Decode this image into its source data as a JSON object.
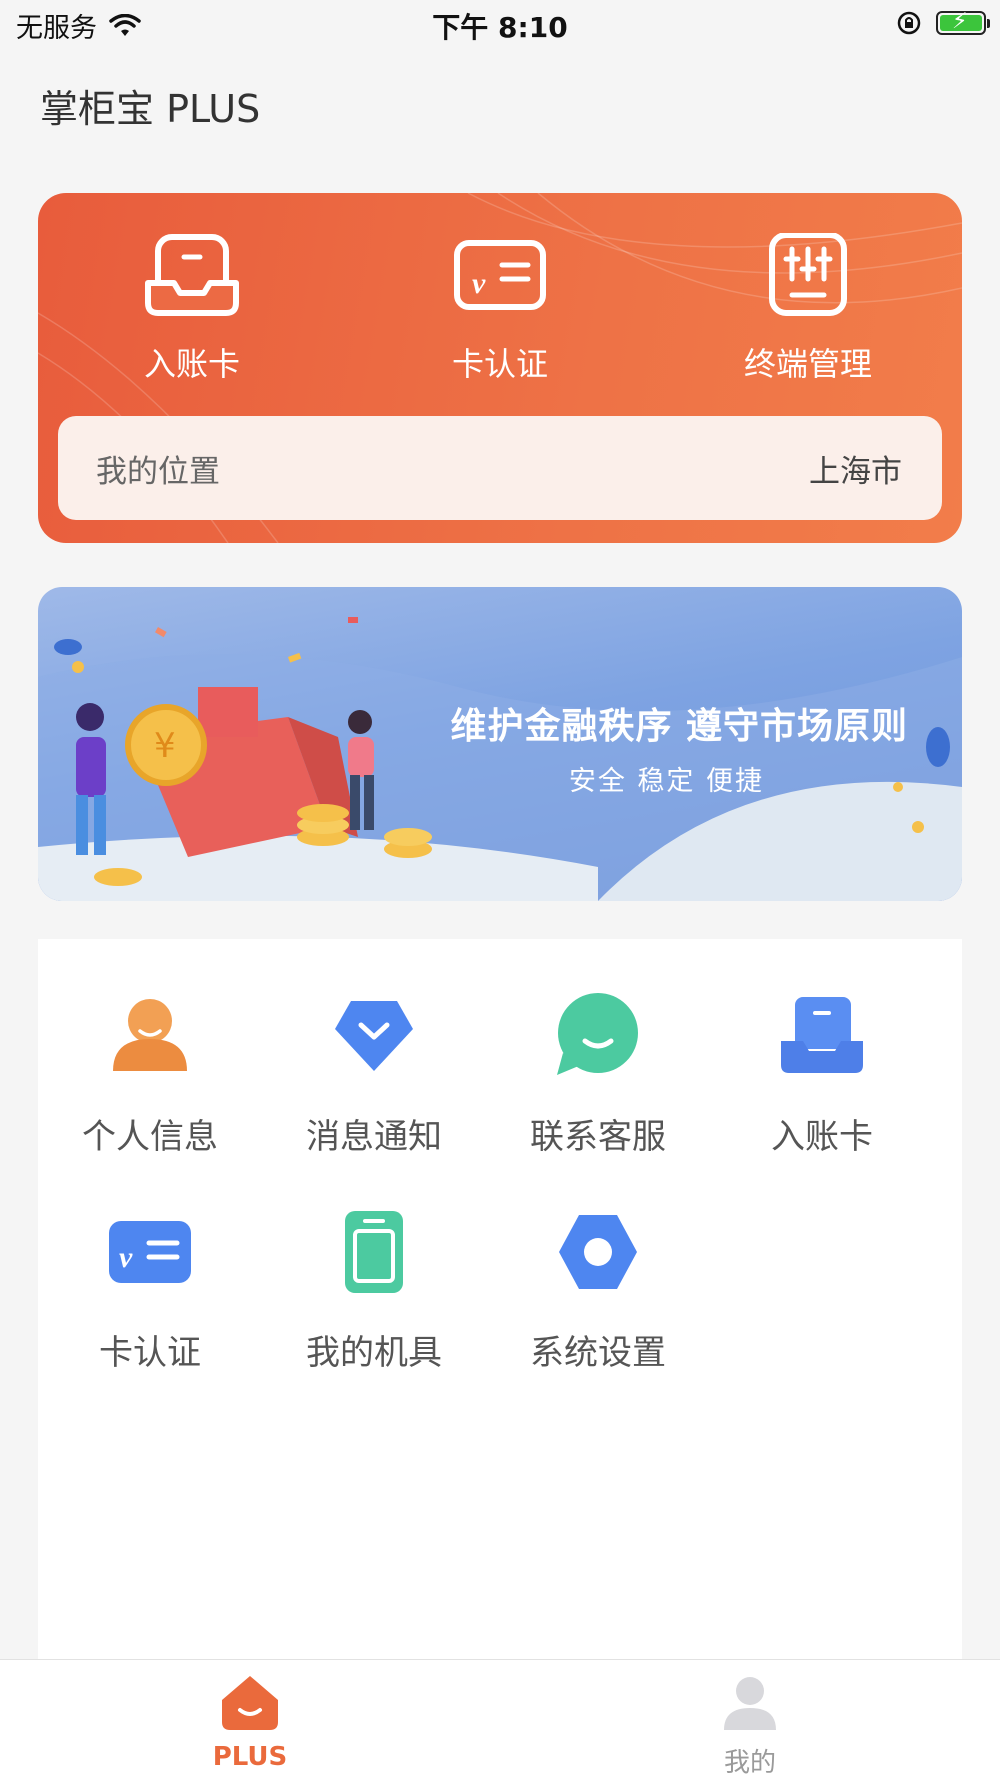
{
  "status_bar": {
    "carrier": "无服务",
    "time": "下午 8:10"
  },
  "app": {
    "title": "掌柜宝 PLUS"
  },
  "quick_actions": [
    {
      "label": "入账卡",
      "icon": "inbox-card-icon"
    },
    {
      "label": "卡认证",
      "icon": "card-verify-icon"
    },
    {
      "label": "终端管理",
      "icon": "terminal-settings-icon"
    }
  ],
  "location": {
    "label": "我的位置",
    "value": "上海市"
  },
  "banner": {
    "title": "维护金融秩序  遵守市场原则",
    "subtitle": "安全  稳定  便捷"
  },
  "menu": [
    {
      "label": "个人信息",
      "icon": "person-icon",
      "color": "#f09a4a"
    },
    {
      "label": "消息通知",
      "icon": "message-icon",
      "color": "#4e86f0"
    },
    {
      "label": "联系客服",
      "icon": "chat-icon",
      "color": "#48c9a0"
    },
    {
      "label": "入账卡",
      "icon": "inbox-card-icon",
      "color": "#4e86f0"
    },
    {
      "label": "卡认证",
      "icon": "card-verify-icon",
      "color": "#4e86f0"
    },
    {
      "label": "我的机具",
      "icon": "device-icon",
      "color": "#48c9a0"
    },
    {
      "label": "系统设置",
      "icon": "settings-icon",
      "color": "#4e86f0"
    }
  ],
  "tabs": [
    {
      "label": "PLUS",
      "active": true,
      "color": "#ea6a3c"
    },
    {
      "label": "我的",
      "active": false,
      "color": "#9a9a9a"
    }
  ]
}
